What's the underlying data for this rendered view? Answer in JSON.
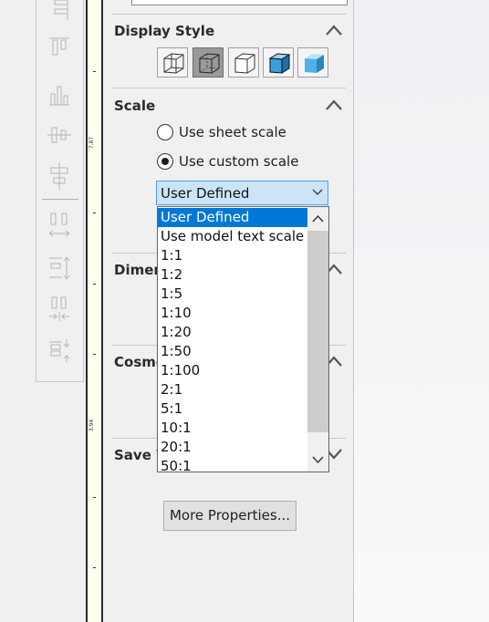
{
  "panel": {
    "display_style": {
      "title": "Display Style",
      "buttons": [
        {
          "name": "wireframe",
          "active": false
        },
        {
          "name": "hidden-lines-visible",
          "active": true
        },
        {
          "name": "hidden-lines-removed",
          "active": false
        },
        {
          "name": "shaded-with-edges",
          "active": false
        },
        {
          "name": "shaded",
          "active": false
        }
      ]
    },
    "scale": {
      "title": "Scale",
      "radio_sheet": "Use sheet scale",
      "radio_custom": "Use custom scale",
      "selected_radio": "custom",
      "combo_value": "User Defined",
      "options": [
        "User Defined",
        "Use model text scale",
        "1:1",
        "1:2",
        "1:5",
        "1:10",
        "1:20",
        "1:50",
        "1:100",
        "2:1",
        "5:1",
        "10:1",
        "20:1",
        "50:1"
      ]
    },
    "dimension_text": {
      "title_visible": "Dimer"
    },
    "cosmetic": {
      "title_visible": "Cosme"
    },
    "save_view": {
      "title_visible": "Save V"
    },
    "more_properties": "More Properties..."
  },
  "ruler": {
    "labels": [
      "7.87",
      "3.94"
    ]
  },
  "colors": {
    "selection": "#0078d7",
    "combo_bg": "#cce4f7",
    "combo_border": "#569de5"
  }
}
